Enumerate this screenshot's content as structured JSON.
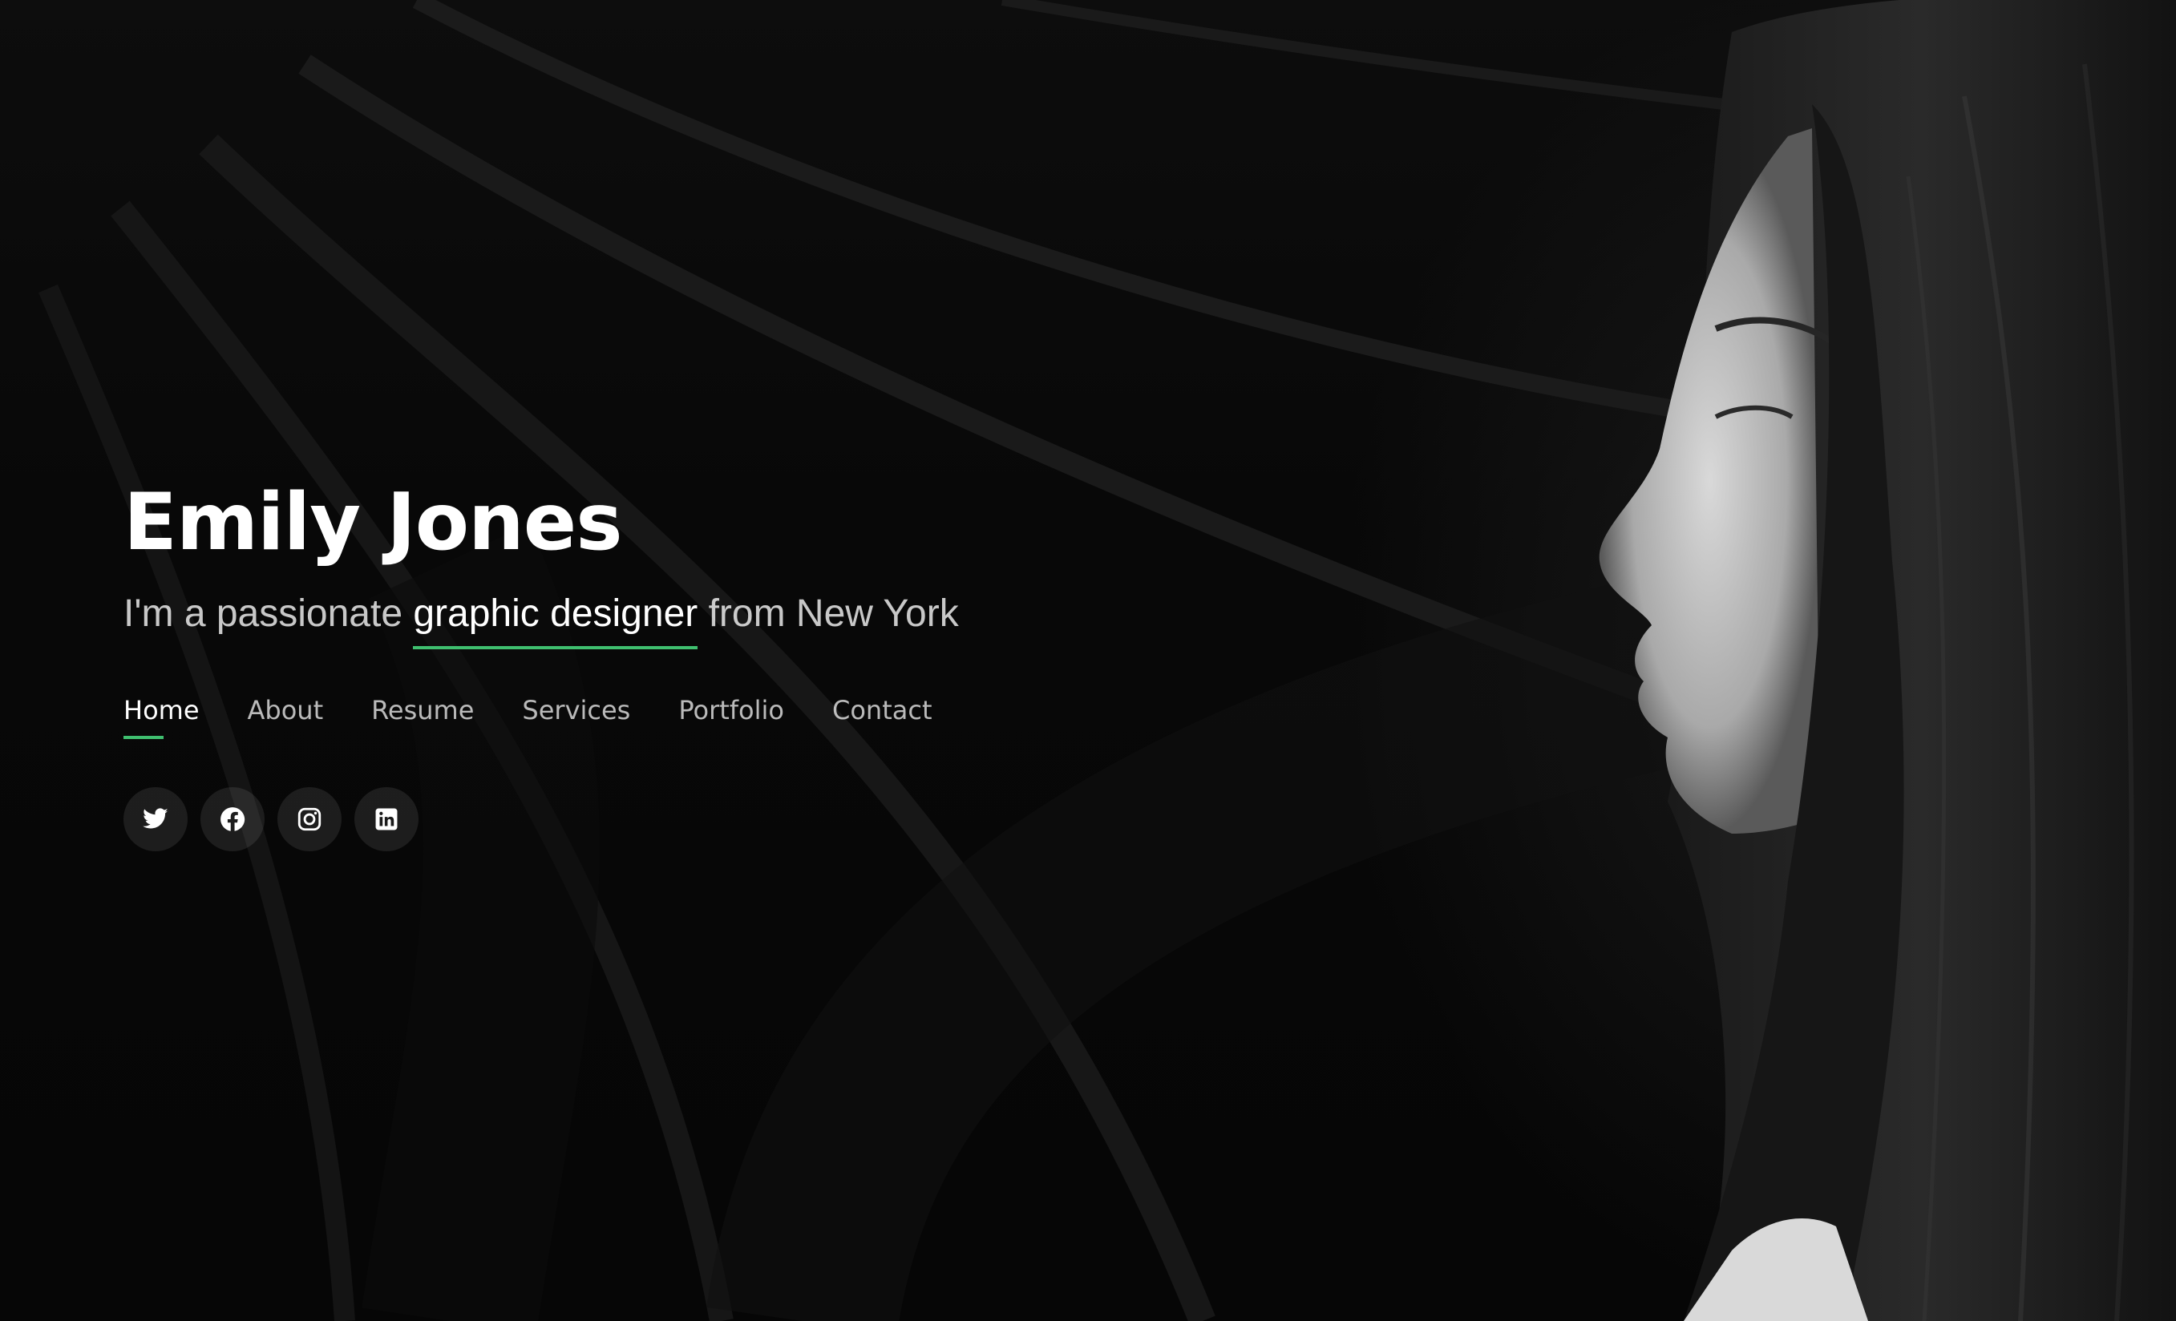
{
  "hero": {
    "name": "Emily Jones",
    "tagline_prefix": "I'm a passionate ",
    "tagline_typed": "graphic designer",
    "tagline_suffix": " from New York"
  },
  "nav": {
    "items": [
      {
        "label": "Home",
        "active": true
      },
      {
        "label": "About",
        "active": false
      },
      {
        "label": "Resume",
        "active": false
      },
      {
        "label": "Services",
        "active": false
      },
      {
        "label": "Portfolio",
        "active": false
      },
      {
        "label": "Contact",
        "active": false
      }
    ]
  },
  "social": {
    "items": [
      {
        "icon": "twitter-icon"
      },
      {
        "icon": "facebook-icon"
      },
      {
        "icon": "instagram-icon"
      },
      {
        "icon": "linkedin-icon"
      }
    ]
  },
  "colors": {
    "accent": "#3fbf6f",
    "background": "#050505",
    "text": "#ffffff"
  }
}
